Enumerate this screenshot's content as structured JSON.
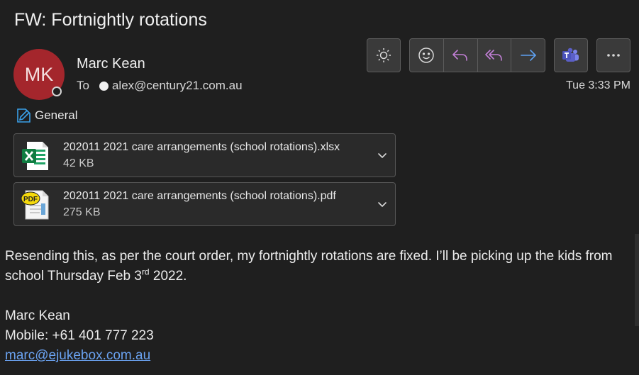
{
  "message": {
    "subject": "FW: Fortnightly rotations",
    "sender_initials": "MK",
    "sender_name": "Marc Kean",
    "to_label": "To",
    "to_address": "alex@century21.com.au",
    "date": "Tue 3:33 PM",
    "category": "General"
  },
  "toolbar": {
    "buttons": [
      "sun-icon",
      "emoji-icon",
      "reply-icon",
      "reply-all-icon",
      "forward-icon",
      "teams-icon",
      "more-icon"
    ]
  },
  "attachments": [
    {
      "name": "202011 2021 care arrangements (school rotations).xlsx",
      "size": "42 KB",
      "icon": "excel-file-icon"
    },
    {
      "name": "202011 2021 care arrangements (school rotations).pdf",
      "size": "275 KB",
      "icon": "pdf-file-icon"
    }
  ],
  "body": {
    "paragraph_main": "Resending this, as per the court order, my fortnightly rotations are fixed. I’ll be picking up the kids from school Thursday Feb 3",
    "superscript": "rd",
    "paragraph_end": " 2022.",
    "sig_name": "Marc Kean",
    "sig_mobile": "Mobile: +61 401 777 223",
    "sig_email": "marc@ejukebox.com.au"
  },
  "colors": {
    "background": "#1f1f1f",
    "avatar": "#a4262c",
    "link": "#6aa2f0",
    "reply_purple": "#c27fd6",
    "forward_blue": "#5ea0ef"
  }
}
